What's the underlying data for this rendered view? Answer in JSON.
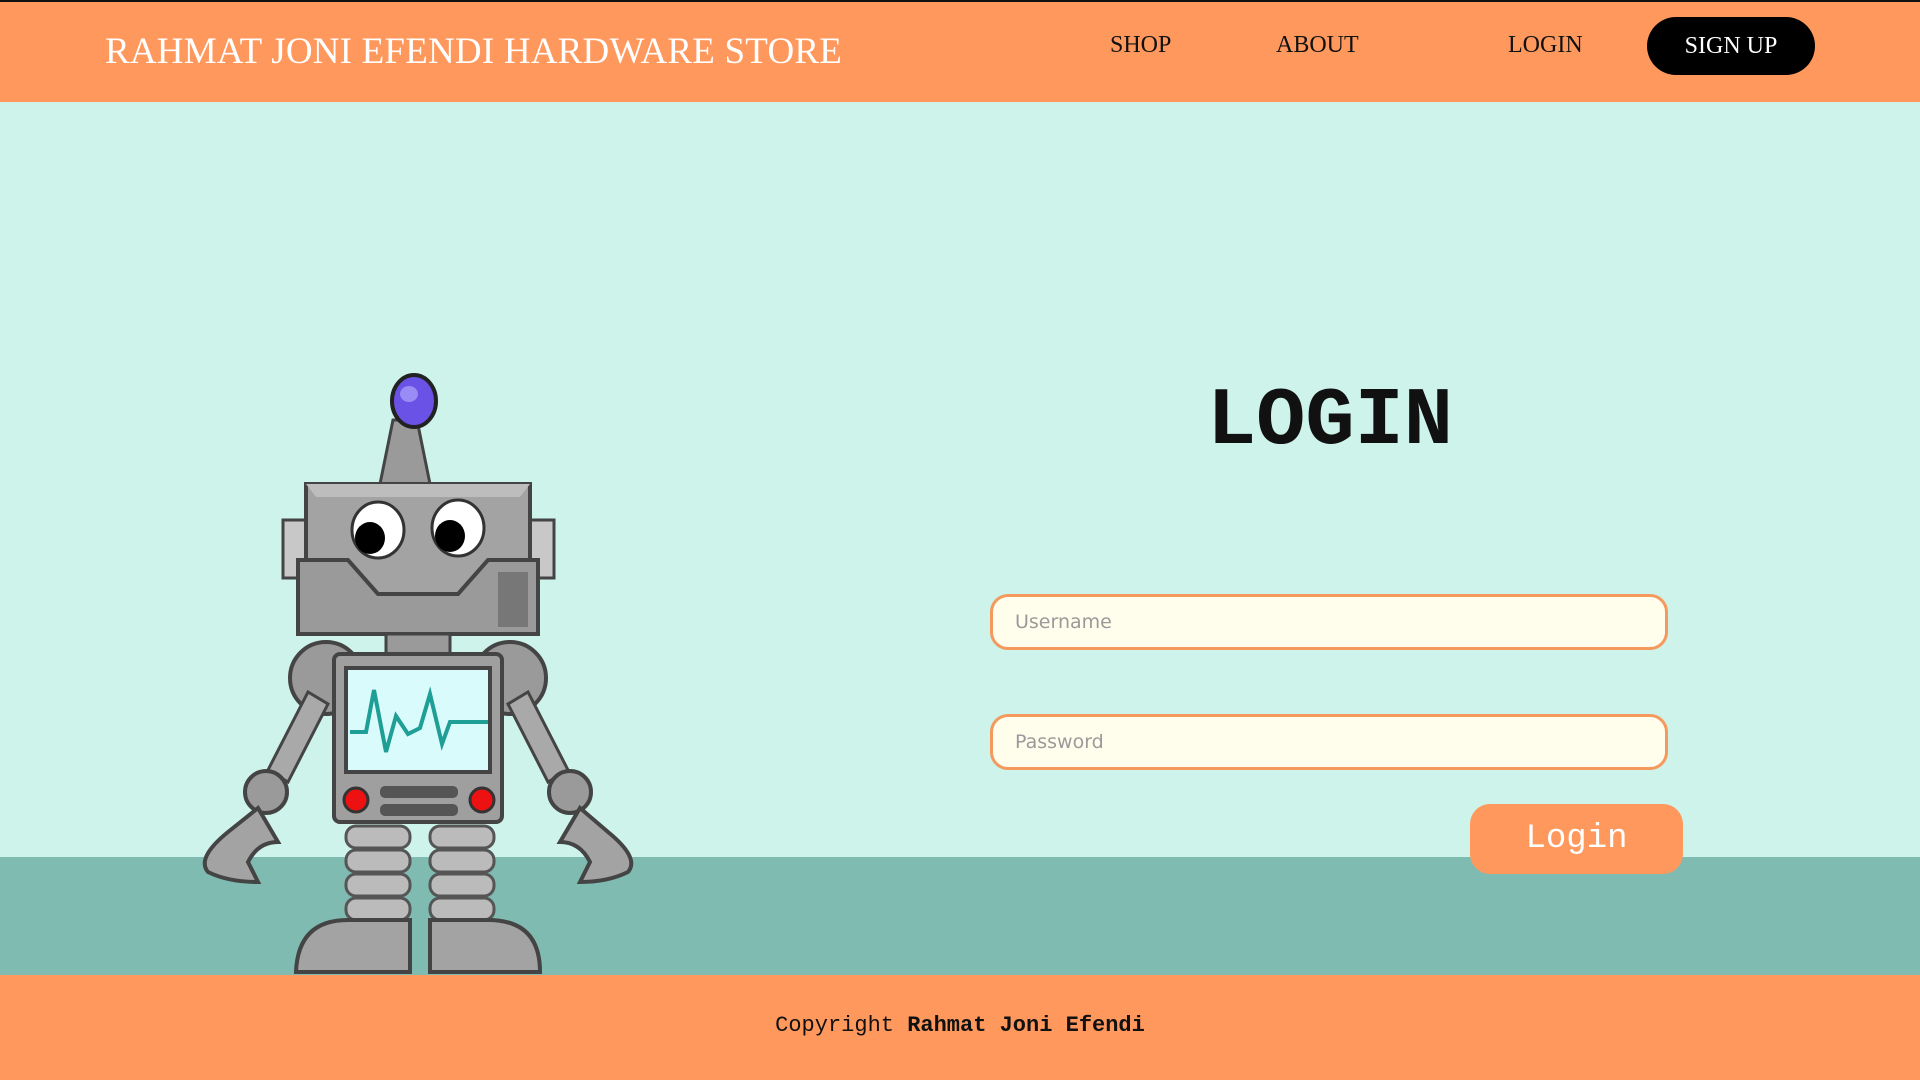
{
  "header": {
    "brand": "RAHMAT JONI EFENDI HARDWARE STORE",
    "nav": {
      "shop": "SHOP",
      "about": "ABOUT",
      "login": "LOGIN",
      "signup": "SIGN UP"
    }
  },
  "login_form": {
    "title": "LOGIN",
    "username_placeholder": "Username",
    "password_placeholder": "Password",
    "submit_label": "Login"
  },
  "footer": {
    "prefix": "Copyright",
    "owner": "Rahmat Joni Efendi"
  },
  "colors": {
    "accent_orange": "#ff985d",
    "sky": "#cdf3ea",
    "ground": "#7fbbb0",
    "input_bg": "#fffdec"
  },
  "illustration": "robot"
}
